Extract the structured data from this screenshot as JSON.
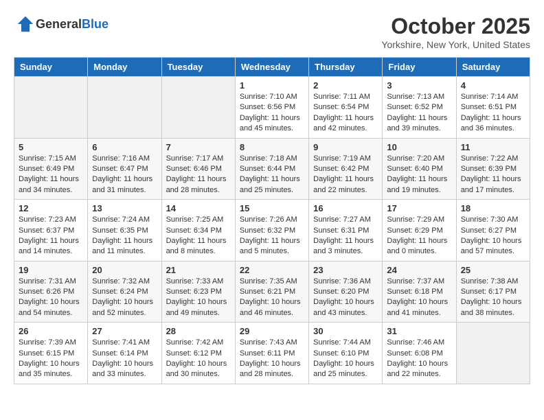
{
  "header": {
    "logo_general": "General",
    "logo_blue": "Blue",
    "month": "October 2025",
    "location": "Yorkshire, New York, United States"
  },
  "weekdays": [
    "Sunday",
    "Monday",
    "Tuesday",
    "Wednesday",
    "Thursday",
    "Friday",
    "Saturday"
  ],
  "weeks": [
    [
      {
        "day": "",
        "info": ""
      },
      {
        "day": "",
        "info": ""
      },
      {
        "day": "",
        "info": ""
      },
      {
        "day": "1",
        "info": "Sunrise: 7:10 AM\nSunset: 6:56 PM\nDaylight: 11 hours\nand 45 minutes."
      },
      {
        "day": "2",
        "info": "Sunrise: 7:11 AM\nSunset: 6:54 PM\nDaylight: 11 hours\nand 42 minutes."
      },
      {
        "day": "3",
        "info": "Sunrise: 7:13 AM\nSunset: 6:52 PM\nDaylight: 11 hours\nand 39 minutes."
      },
      {
        "day": "4",
        "info": "Sunrise: 7:14 AM\nSunset: 6:51 PM\nDaylight: 11 hours\nand 36 minutes."
      }
    ],
    [
      {
        "day": "5",
        "info": "Sunrise: 7:15 AM\nSunset: 6:49 PM\nDaylight: 11 hours\nand 34 minutes."
      },
      {
        "day": "6",
        "info": "Sunrise: 7:16 AM\nSunset: 6:47 PM\nDaylight: 11 hours\nand 31 minutes."
      },
      {
        "day": "7",
        "info": "Sunrise: 7:17 AM\nSunset: 6:46 PM\nDaylight: 11 hours\nand 28 minutes."
      },
      {
        "day": "8",
        "info": "Sunrise: 7:18 AM\nSunset: 6:44 PM\nDaylight: 11 hours\nand 25 minutes."
      },
      {
        "day": "9",
        "info": "Sunrise: 7:19 AM\nSunset: 6:42 PM\nDaylight: 11 hours\nand 22 minutes."
      },
      {
        "day": "10",
        "info": "Sunrise: 7:20 AM\nSunset: 6:40 PM\nDaylight: 11 hours\nand 19 minutes."
      },
      {
        "day": "11",
        "info": "Sunrise: 7:22 AM\nSunset: 6:39 PM\nDaylight: 11 hours\nand 17 minutes."
      }
    ],
    [
      {
        "day": "12",
        "info": "Sunrise: 7:23 AM\nSunset: 6:37 PM\nDaylight: 11 hours\nand 14 minutes."
      },
      {
        "day": "13",
        "info": "Sunrise: 7:24 AM\nSunset: 6:35 PM\nDaylight: 11 hours\nand 11 minutes."
      },
      {
        "day": "14",
        "info": "Sunrise: 7:25 AM\nSunset: 6:34 PM\nDaylight: 11 hours\nand 8 minutes."
      },
      {
        "day": "15",
        "info": "Sunrise: 7:26 AM\nSunset: 6:32 PM\nDaylight: 11 hours\nand 5 minutes."
      },
      {
        "day": "16",
        "info": "Sunrise: 7:27 AM\nSunset: 6:31 PM\nDaylight: 11 hours\nand 3 minutes."
      },
      {
        "day": "17",
        "info": "Sunrise: 7:29 AM\nSunset: 6:29 PM\nDaylight: 11 hours\nand 0 minutes."
      },
      {
        "day": "18",
        "info": "Sunrise: 7:30 AM\nSunset: 6:27 PM\nDaylight: 10 hours\nand 57 minutes."
      }
    ],
    [
      {
        "day": "19",
        "info": "Sunrise: 7:31 AM\nSunset: 6:26 PM\nDaylight: 10 hours\nand 54 minutes."
      },
      {
        "day": "20",
        "info": "Sunrise: 7:32 AM\nSunset: 6:24 PM\nDaylight: 10 hours\nand 52 minutes."
      },
      {
        "day": "21",
        "info": "Sunrise: 7:33 AM\nSunset: 6:23 PM\nDaylight: 10 hours\nand 49 minutes."
      },
      {
        "day": "22",
        "info": "Sunrise: 7:35 AM\nSunset: 6:21 PM\nDaylight: 10 hours\nand 46 minutes."
      },
      {
        "day": "23",
        "info": "Sunrise: 7:36 AM\nSunset: 6:20 PM\nDaylight: 10 hours\nand 43 minutes."
      },
      {
        "day": "24",
        "info": "Sunrise: 7:37 AM\nSunset: 6:18 PM\nDaylight: 10 hours\nand 41 minutes."
      },
      {
        "day": "25",
        "info": "Sunrise: 7:38 AM\nSunset: 6:17 PM\nDaylight: 10 hours\nand 38 minutes."
      }
    ],
    [
      {
        "day": "26",
        "info": "Sunrise: 7:39 AM\nSunset: 6:15 PM\nDaylight: 10 hours\nand 35 minutes."
      },
      {
        "day": "27",
        "info": "Sunrise: 7:41 AM\nSunset: 6:14 PM\nDaylight: 10 hours\nand 33 minutes."
      },
      {
        "day": "28",
        "info": "Sunrise: 7:42 AM\nSunset: 6:12 PM\nDaylight: 10 hours\nand 30 minutes."
      },
      {
        "day": "29",
        "info": "Sunrise: 7:43 AM\nSunset: 6:11 PM\nDaylight: 10 hours\nand 28 minutes."
      },
      {
        "day": "30",
        "info": "Sunrise: 7:44 AM\nSunset: 6:10 PM\nDaylight: 10 hours\nand 25 minutes."
      },
      {
        "day": "31",
        "info": "Sunrise: 7:46 AM\nSunset: 6:08 PM\nDaylight: 10 hours\nand 22 minutes."
      },
      {
        "day": "",
        "info": ""
      }
    ]
  ]
}
